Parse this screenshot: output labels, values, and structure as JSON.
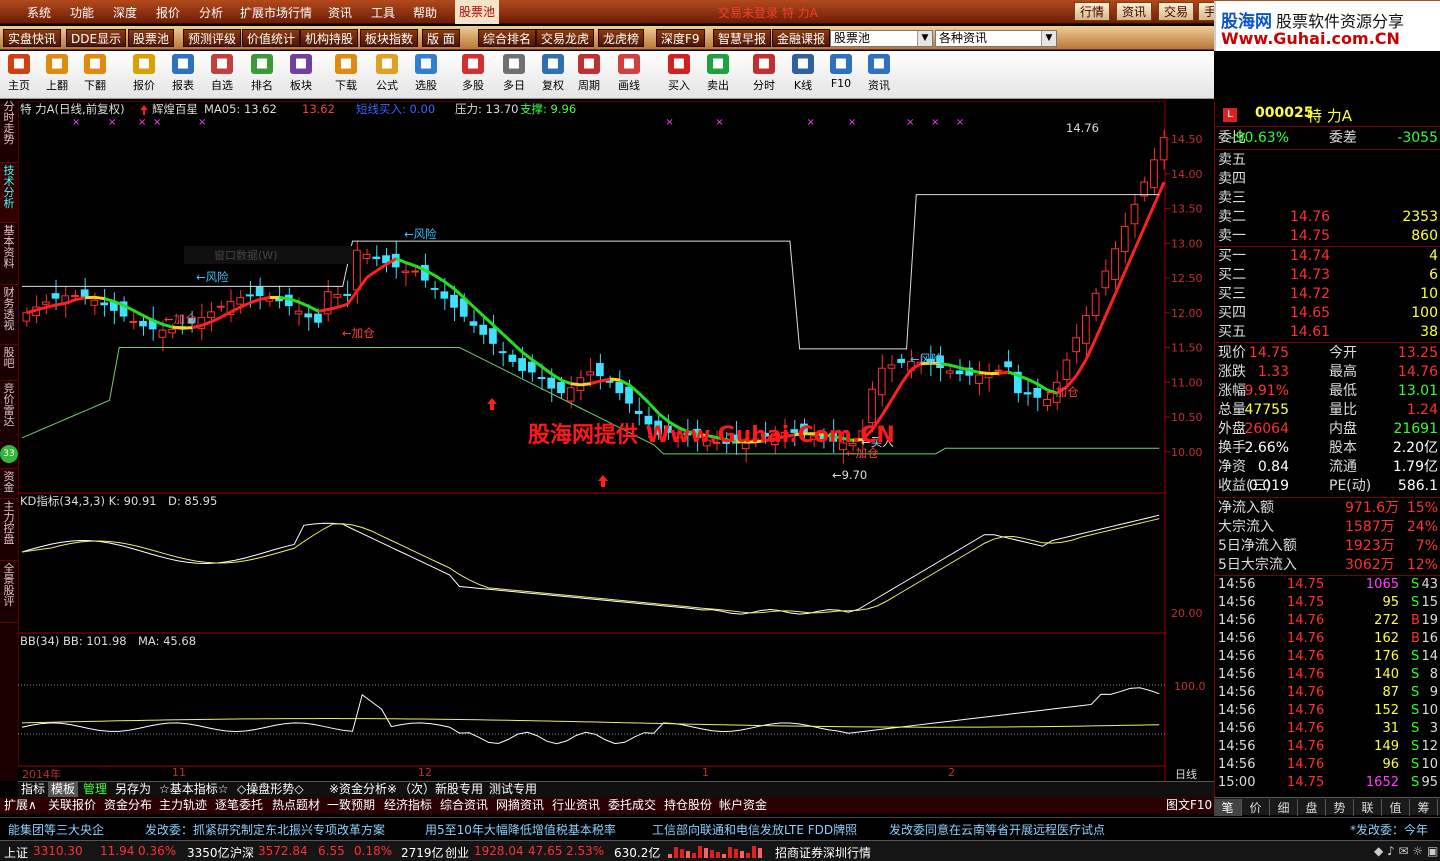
{
  "window_title": "交易未登录  特  力A",
  "menu": {
    "items": [
      "系统",
      "功能",
      "深度",
      "报价",
      "分析",
      "扩展市场行情",
      "资讯",
      "工具",
      "帮助"
    ],
    "active": "股票池"
  },
  "top_right": {
    "buttons": [
      "行情",
      "资讯",
      "交易",
      "手"
    ]
  },
  "banner": {
    "brand": "股海网",
    "slogan": "股票软件资源分享",
    "url": "Www.Guhai.com.CN"
  },
  "quickbar": {
    "buttons": [
      "实盘快讯",
      "DDE显示",
      "股票池",
      "预测评级",
      "价值统计",
      "机构持股",
      "板块指数",
      "版 面",
      "综合排名",
      "交易龙虎",
      "龙虎榜",
      "深度F9",
      "智慧早报",
      "金融课报"
    ],
    "select1": "股票池",
    "select2": "各种资讯"
  },
  "toolbar": {
    "items": [
      {
        "label": "主页",
        "icon": "home-icon",
        "color": "#d04010"
      },
      {
        "label": "上翻",
        "icon": "arrow-up-icon",
        "color": "#e08a10"
      },
      {
        "label": "下翻",
        "icon": "arrow-down-icon",
        "color": "#e08a10"
      },
      {
        "label": "报价",
        "icon": "quote-icon",
        "color": "#d8a000"
      },
      {
        "label": "报表",
        "icon": "report-icon",
        "color": "#3070c0"
      },
      {
        "label": "自选",
        "icon": "favorites-icon",
        "color": "#c04040"
      },
      {
        "label": "排名",
        "icon": "ranking-icon",
        "color": "#3a9a3a"
      },
      {
        "label": "板块",
        "icon": "sector-icon",
        "color": "#7040a0"
      },
      {
        "label": "下载",
        "icon": "download-icon",
        "color": "#e08a10"
      },
      {
        "label": "公式",
        "icon": "formula-icon",
        "color": "#e0a020"
      },
      {
        "label": "选股",
        "icon": "stock-picker-icon",
        "color": "#3080d0"
      },
      {
        "label": "多股",
        "icon": "multi-stock-icon",
        "color": "#d03030"
      },
      {
        "label": "多日",
        "icon": "multi-day-icon",
        "color": "#707070"
      },
      {
        "label": "复权",
        "icon": "adjust-icon",
        "color": "#3070b0"
      },
      {
        "label": "周期",
        "icon": "period-icon",
        "color": "#c03030"
      },
      {
        "label": "画线",
        "icon": "draw-line-icon",
        "color": "#d04040"
      },
      {
        "label": "买入",
        "icon": "buy-icon",
        "color": "#d02020"
      },
      {
        "label": "卖出",
        "icon": "sell-icon",
        "color": "#20a040"
      },
      {
        "label": "分时",
        "icon": "intraday-icon",
        "color": "#c03030"
      },
      {
        "label": "K线",
        "icon": "kline-icon",
        "color": "#3060a0"
      },
      {
        "label": "F10",
        "icon": "f10-icon",
        "color": "#3070c0"
      },
      {
        "label": "资讯",
        "icon": "news-icon",
        "color": "#3070c0"
      }
    ]
  },
  "side_tabs": [
    "分时走势",
    "技术分析",
    "基本资料",
    "财务透视",
    "股吧",
    "竞价雷达",
    "资金",
    "主力控盘",
    "全景股评"
  ],
  "side_badge": "33",
  "main_chart": {
    "header": {
      "name": "特  力A(日线,前复权)",
      "indicator": "辉煌百星",
      "ma05": "MA05: 13.62",
      "ma_val": "13.62",
      "signal": "短线买入: 0.00",
      "pressure": "压力: 13.70",
      "support": "支撑: 9.96"
    },
    "labels": {
      "risk": "←风险",
      "add": "←加仓",
      "buy": "←买入",
      "high": "14.76",
      "low": "←9.70",
      "dialog_hint": "窗口数据(W)"
    },
    "y_ticks": [
      "14.50",
      "14.00",
      "13.50",
      "13.00",
      "12.50",
      "12.00",
      "11.50",
      "11.00",
      "10.50",
      "10.00"
    ]
  },
  "kd_chart": {
    "header": "KD指标(34,3,3)  K: 90.91",
    "d_text": "D: 85.95",
    "y_tick": "20.00"
  },
  "bb_chart": {
    "header": "BB(34)  BB: 101.98",
    "ma_text": "MA: 45.68",
    "y_tick": "100.0"
  },
  "x_axis": {
    "labels": [
      "2014年",
      "11",
      "12",
      "1",
      "2"
    ],
    "period": "日线"
  },
  "bottom_tabs": [
    "指标",
    "模板",
    "管理",
    "另存为",
    "☆基本指标☆",
    "◇操盘形势◇",
    "※资金分析※",
    "（次）新股专用",
    "测试专用"
  ],
  "func_tabs": [
    "扩展∧",
    "关联报价",
    "资金分布",
    "主力轨迹",
    "逐笔委托",
    "热点题材",
    "一致预期",
    "经济指标",
    "综合资讯",
    "网摘资讯",
    "行业资讯",
    "委托成交",
    "持仓股份",
    "帐户资金",
    "图文F10"
  ],
  "right_panel": {
    "code": "000025",
    "name": "特  力A",
    "commit": {
      "ratio_label": "委比",
      "ratio": "-90.63%",
      "diff_label": "委差",
      "diff": "-3055"
    },
    "sells": [
      {
        "l": "卖五",
        "p": "",
        "v": ""
      },
      {
        "l": "卖四",
        "p": "",
        "v": ""
      },
      {
        "l": "卖三",
        "p": "",
        "v": ""
      },
      {
        "l": "卖二",
        "p": "14.76",
        "v": "2353"
      },
      {
        "l": "卖一",
        "p": "14.75",
        "v": "860"
      }
    ],
    "buys": [
      {
        "l": "买一",
        "p": "14.74",
        "v": "4"
      },
      {
        "l": "买二",
        "p": "14.73",
        "v": "6"
      },
      {
        "l": "买三",
        "p": "14.72",
        "v": "10"
      },
      {
        "l": "买四",
        "p": "14.65",
        "v": "100"
      },
      {
        "l": "买五",
        "p": "14.61",
        "v": "38"
      }
    ],
    "stats": [
      {
        "a": "现价",
        "b": "14.75",
        "c": "今开",
        "d": "13.25",
        "bc": "red",
        "dc": "red"
      },
      {
        "a": "涨跌",
        "b": "1.33",
        "c": "最高",
        "d": "14.76",
        "bc": "red",
        "dc": "red"
      },
      {
        "a": "涨幅",
        "b": "9.91%",
        "c": "最低",
        "d": "13.01",
        "bc": "red",
        "dc": "grn"
      },
      {
        "a": "总量",
        "b": "47755",
        "c": "量比",
        "d": "1.24",
        "bc": "yel",
        "dc": "red"
      },
      {
        "a": "外盘",
        "b": "26064",
        "c": "内盘",
        "d": "21691",
        "bc": "red",
        "dc": "grn"
      },
      {
        "a": "换手",
        "b": "2.66%",
        "c": "股本",
        "d": "2.20亿",
        "bc": "wht",
        "dc": "wht"
      },
      {
        "a": "净资",
        "b": "0.84",
        "c": "流通",
        "d": "1.79亿",
        "bc": "wht",
        "dc": "wht"
      },
      {
        "a": "收益(三)",
        "b": "0.019",
        "c": "PE(动)",
        "d": "586.1",
        "bc": "wht",
        "dc": "wht"
      }
    ],
    "flows": [
      {
        "a": "净流入额",
        "b": "971.6万",
        "c": "15%"
      },
      {
        "a": "大宗流入",
        "b": "1587万",
        "c": "24%"
      },
      {
        "a": "5日净流入额",
        "b": "1923万",
        "c": "7%"
      },
      {
        "a": "5日大宗流入",
        "b": "3062万",
        "c": "12%"
      }
    ],
    "ticks": [
      {
        "t": "14:56",
        "p": "14.75",
        "v": "1065",
        "s": "S",
        "n": "43"
      },
      {
        "t": "14:56",
        "p": "14.75",
        "v": "95",
        "s": "S",
        "n": "15"
      },
      {
        "t": "14:56",
        "p": "14.76",
        "v": "272",
        "s": "B",
        "n": "19"
      },
      {
        "t": "14:56",
        "p": "14.76",
        "v": "162",
        "s": "B",
        "n": "16"
      },
      {
        "t": "14:56",
        "p": "14.76",
        "v": "176",
        "s": "S",
        "n": "14"
      },
      {
        "t": "14:56",
        "p": "14.76",
        "v": "140",
        "s": "S",
        "n": "8"
      },
      {
        "t": "14:56",
        "p": "14.76",
        "v": "87",
        "s": "S",
        "n": "9"
      },
      {
        "t": "14:56",
        "p": "14.76",
        "v": "152",
        "s": "S",
        "n": "10"
      },
      {
        "t": "14:56",
        "p": "14.76",
        "v": "31",
        "s": "S",
        "n": "3"
      },
      {
        "t": "14:56",
        "p": "14.76",
        "v": "149",
        "s": "S",
        "n": "12"
      },
      {
        "t": "14:56",
        "p": "14.76",
        "v": "96",
        "s": "S",
        "n": "10"
      },
      {
        "t": "15:00",
        "p": "14.75",
        "v": "1652",
        "s": "S",
        "n": "95"
      }
    ],
    "tabs": [
      "笔",
      "价",
      "细",
      "盘",
      "势",
      "联",
      "值",
      "筹"
    ]
  },
  "ticker": [
    "能集团等三大央企",
    "发改委：抓紧研究制定东北振兴专项改革方案",
    "用5至10年大幅降低增值税基本税率",
    "工信部向联通和电信发放LTE FDD牌照",
    "发改委同意在云南等省开展远程医疗试点",
    "*发改委：今年"
  ],
  "status": {
    "sh_label": "上证",
    "sh": "3310.30",
    "sh_chg": "11.94",
    "sh_pct": "0.36%",
    "sh_amt": "3350亿",
    "sz_label": "沪深",
    "sz": "3572.84",
    "sz_chg": "6.55",
    "sz_pct": "0.18%",
    "sz_amt": "2719亿",
    "cy_label": "创业",
    "cy": "1928.04",
    "cy_chg": "47.65",
    "cy_pct": "2.53%",
    "cy_amt": "630.2亿",
    "broker": "招商证券深圳行情"
  },
  "watermark": "股海网提供 Www.Guhai.Com.CN"
}
